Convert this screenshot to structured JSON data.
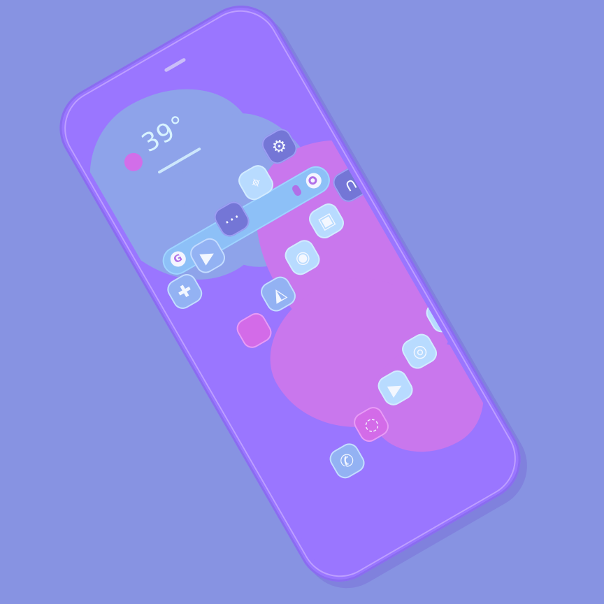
{
  "weather": {
    "temperature": "39°"
  },
  "home_screen": {
    "search_bar": {
      "google_logo": "G"
    },
    "app_icons": [
      {
        "name": "photos-icon"
      },
      {
        "name": "play-store-icon"
      },
      {
        "name": "apps-drawer-icon"
      },
      {
        "name": "maps-icon"
      },
      {
        "name": "settings-icon"
      },
      {
        "name": "play-games-icon"
      },
      {
        "name": "message-icon"
      },
      {
        "name": "shop-icon"
      },
      {
        "name": "folder-icon"
      },
      {
        "name": "store-icon"
      }
    ],
    "dock": [
      {
        "name": "phone-icon"
      },
      {
        "name": "camera-icon"
      },
      {
        "name": "play-icon"
      },
      {
        "name": "chrome-icon"
      },
      {
        "name": "gmail-icon"
      }
    ]
  }
}
